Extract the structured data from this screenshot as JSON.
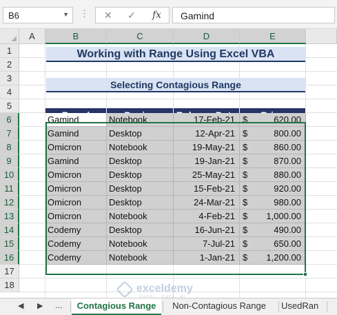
{
  "formula_bar": {
    "name_box": "B6",
    "cancel_icon": "✕",
    "enter_icon": "✓",
    "fx_label": "fx",
    "formula": "Gamind"
  },
  "columns": [
    "A",
    "B",
    "C",
    "D",
    "E"
  ],
  "rows": [
    "1",
    "2",
    "3",
    "4",
    "5",
    "6",
    "7",
    "8",
    "9",
    "10",
    "11",
    "12",
    "13",
    "14",
    "15",
    "16",
    "17",
    "18"
  ],
  "selected_column_headers": [
    "B",
    "C",
    "D",
    "E"
  ],
  "selected_row_headers": [
    "6",
    "7",
    "8",
    "9",
    "10",
    "11",
    "12",
    "13",
    "14",
    "15",
    "16"
  ],
  "sheet": {
    "title": "Working with Range Using Excel VBA",
    "subtitle": "Selecting Contagious Range",
    "headers": [
      "Brand",
      "Device",
      "Release Date",
      "Price"
    ],
    "data": [
      {
        "brand": "Gamind",
        "device": "Notebook",
        "date": "17-Feb-21",
        "cur": "$",
        "price": "620.00"
      },
      {
        "brand": "Gamind",
        "device": "Desktop",
        "date": "12-Apr-21",
        "cur": "$",
        "price": "800.00"
      },
      {
        "brand": "Omicron",
        "device": "Notebook",
        "date": "19-May-21",
        "cur": "$",
        "price": "860.00"
      },
      {
        "brand": "Gamind",
        "device": "Desktop",
        "date": "19-Jan-21",
        "cur": "$",
        "price": "870.00"
      },
      {
        "brand": "Omicron",
        "device": "Desktop",
        "date": "25-May-21",
        "cur": "$",
        "price": "880.00"
      },
      {
        "brand": "Omicron",
        "device": "Desktop",
        "date": "15-Feb-21",
        "cur": "$",
        "price": "920.00"
      },
      {
        "brand": "Omicron",
        "device": "Desktop",
        "date": "24-Mar-21",
        "cur": "$",
        "price": "980.00"
      },
      {
        "brand": "Omicron",
        "device": "Notebook",
        "date": "4-Feb-21",
        "cur": "$",
        "price": "1,000.00"
      },
      {
        "brand": "Codemy",
        "device": "Desktop",
        "date": "16-Jun-21",
        "cur": "$",
        "price": "490.00"
      },
      {
        "brand": "Codemy",
        "device": "Notebook",
        "date": "7-Jul-21",
        "cur": "$",
        "price": "650.00"
      },
      {
        "brand": "Codemy",
        "device": "Notebook",
        "date": "1-Jan-21",
        "cur": "$",
        "price": "1,200.00"
      }
    ]
  },
  "watermark": {
    "name": "exceldemy",
    "tagline": "EXCEL · DATA · BI"
  },
  "tabs": {
    "nav_prev": "◀",
    "nav_next": "▶",
    "more": "...",
    "items": [
      "Contagious Range",
      "Non-Contagious Range",
      "UsedRan"
    ],
    "active_index": 0
  },
  "colors": {
    "header_fill": "#283468",
    "title_fill": "#dae3f3",
    "title_text": "#1f3864",
    "selection_fill": "#d0d0d0",
    "selection_border": "#217346"
  }
}
